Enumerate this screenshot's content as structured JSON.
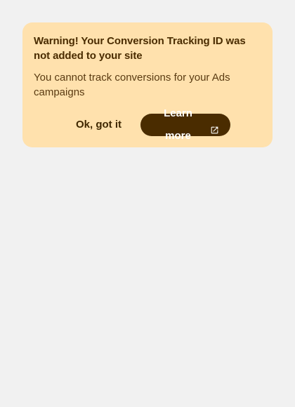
{
  "banner": {
    "title": "Warning! Your Conversion Tracking ID was not added to your site",
    "body": "You cannot track conversions for your Ads campaigns",
    "dismiss_label": "Ok, got it",
    "learn_more_label": "Learn more",
    "learn_more_icon": "open-in-new-icon"
  },
  "colors": {
    "background": "#f1f1f1",
    "banner_bg": "#ffe1ad",
    "text": "#4a2c00",
    "primary_button": "#4a2c00"
  }
}
